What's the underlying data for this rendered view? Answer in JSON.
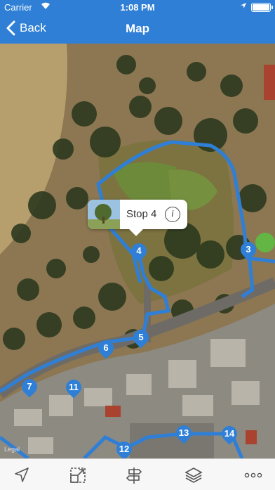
{
  "status": {
    "carrier": "Carrier",
    "time": "1:08 PM"
  },
  "nav": {
    "back_label": "Back",
    "title": "Map"
  },
  "callout": {
    "label": "Stop 4",
    "info_glyph": "i"
  },
  "markers": [
    "3",
    "4",
    "5",
    "6",
    "7",
    "11",
    "12",
    "13",
    "14"
  ],
  "map": {
    "legal": "Legal"
  },
  "toolbar": {
    "icons": [
      "location-arrow-icon",
      "resize-expand-icon",
      "signpost-icon",
      "layers-icon",
      "more-icon"
    ]
  },
  "colors": {
    "accent": "#2f7fd6"
  }
}
